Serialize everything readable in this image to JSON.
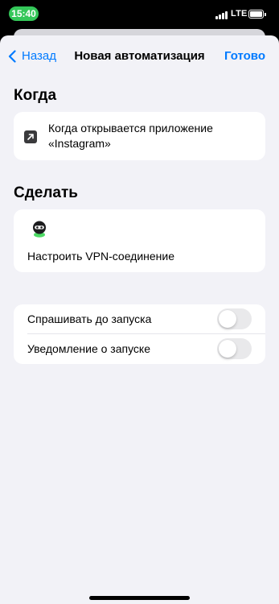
{
  "status_bar": {
    "time": "15:40",
    "network": "LTE",
    "colors": {
      "time_pill": "#34c759"
    }
  },
  "nav": {
    "back_label": "Назад",
    "title": "Новая автоматизация",
    "done_label": "Готово",
    "back_icon": "chevron-left-icon",
    "accent_color": "#007aff"
  },
  "when": {
    "section_title": "Когда",
    "trigger_text": "Когда открывается приложение «Instagram»",
    "icon": "app-open-arrow-icon"
  },
  "do": {
    "section_title": "Сделать",
    "action_label": "Настроить VPN-соединение",
    "icon": "vpn-app-icon"
  },
  "settings": [
    {
      "label": "Спрашивать до запуска",
      "enabled": false
    },
    {
      "label": "Уведомление о запуске",
      "enabled": false
    }
  ]
}
